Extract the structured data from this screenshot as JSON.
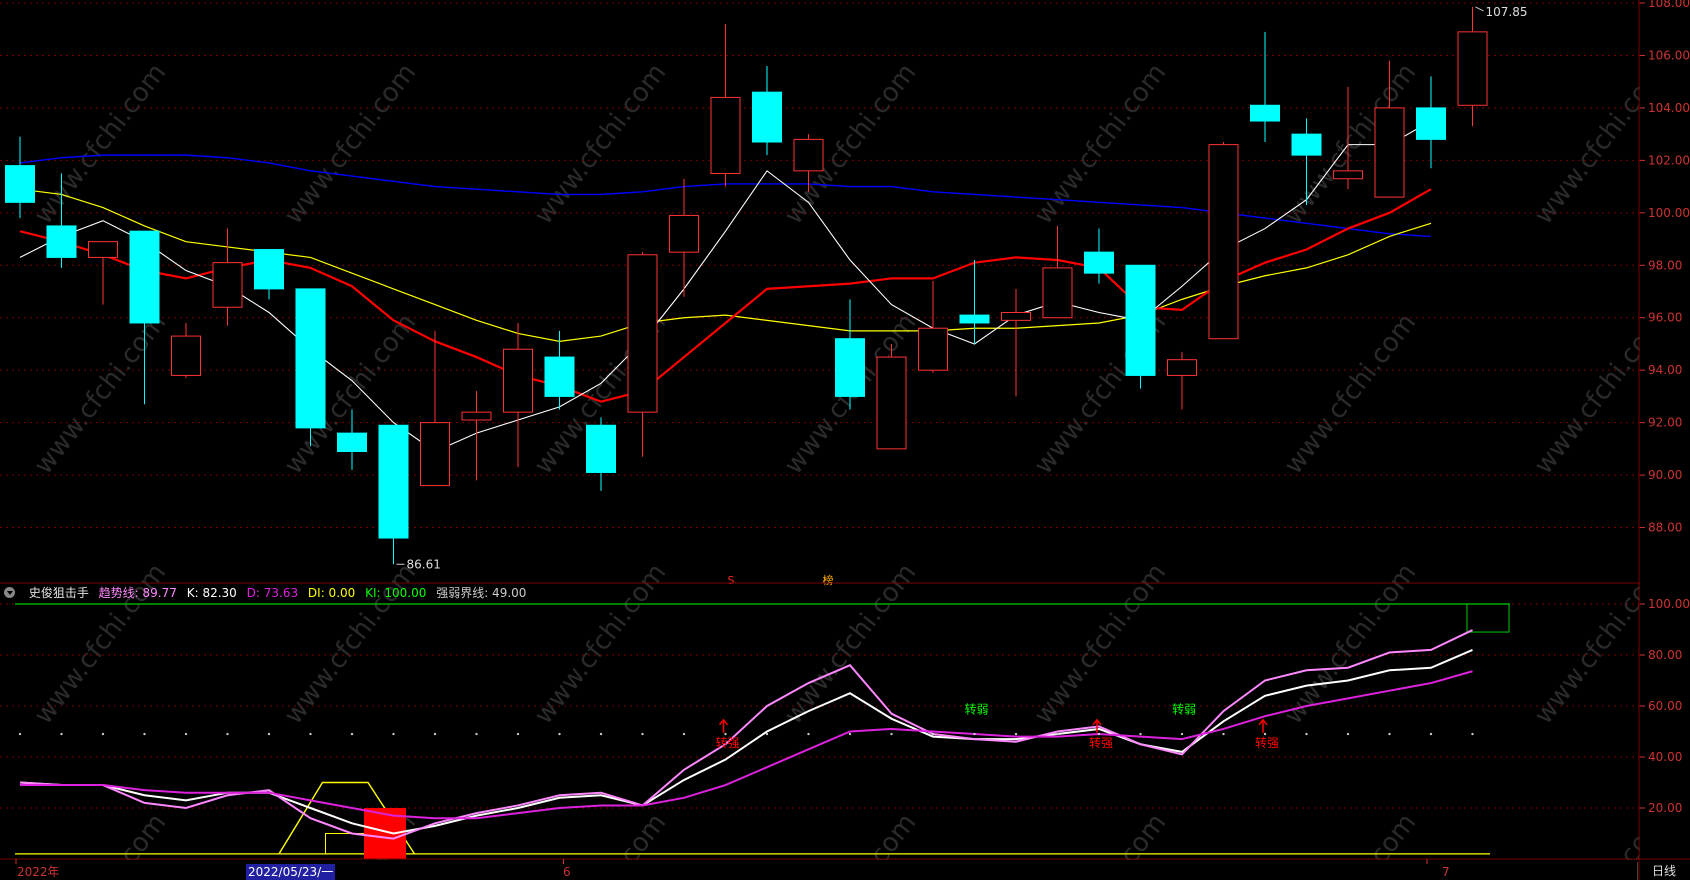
{
  "colors": {
    "up": "#ff3232",
    "down": "#00ffff",
    "ma_white": "#ffffff",
    "ma_red": "#ff0000",
    "ma_yellow": "#ffff00",
    "ma_blue": "#0000ff",
    "grid": "#7a0000",
    "axis_text": "#cc3333"
  },
  "indicator_header": {
    "name": "史俊狙击手",
    "trend_label": "趋势线: 89.77",
    "k_label": "K: 82.30",
    "d_label": "D: 73.63",
    "di_label": "DI: 0.00",
    "ki_label": "KI: 100.00",
    "strong_weak_label": "强弱界线: 49.00"
  },
  "markers": {
    "high_label": "107.85",
    "low_label": "86.61",
    "s_label": "S",
    "bang_label": "榜"
  },
  "signals": [
    {
      "text": "转强",
      "index": 17,
      "value": 44,
      "color": "#ff0000"
    },
    {
      "text": "转弱",
      "index": 23,
      "value": 57,
      "color": "#00ff00"
    },
    {
      "text": "转强",
      "index": 26,
      "value": 44,
      "color": "#ff0000"
    },
    {
      "text": "转弱",
      "index": 28,
      "value": 57,
      "color": "#00ff00"
    },
    {
      "text": "转强",
      "index": 30,
      "value": 44,
      "color": "#ff0000"
    }
  ],
  "timeline": {
    "year_label": "2022年",
    "selected_date": "2022/05/23/一",
    "month_6": "6",
    "month_7": "7",
    "period_button": "日线"
  },
  "chart_data": [
    {
      "type": "candlestick",
      "ylim": [
        86,
        108
      ],
      "yticks": [
        "88.00",
        "90.00",
        "92.00",
        "94.00",
        "96.00",
        "98.00",
        "100.00",
        "102.00",
        "104.00",
        "106.00",
        "108.00"
      ],
      "candles": [
        {
          "o": 101.8,
          "h": 102.9,
          "l": 99.8,
          "c": 100.4
        },
        {
          "o": 99.5,
          "h": 101.5,
          "l": 97.9,
          "c": 98.3
        },
        {
          "o": 98.3,
          "h": 98.9,
          "l": 96.5,
          "c": 98.9
        },
        {
          "o": 99.3,
          "h": 99.3,
          "l": 92.7,
          "c": 95.8
        },
        {
          "o": 93.8,
          "h": 95.8,
          "l": 93.7,
          "c": 95.3
        },
        {
          "o": 96.4,
          "h": 99.4,
          "l": 95.7,
          "c": 98.1
        },
        {
          "o": 98.6,
          "h": 98.6,
          "l": 96.7,
          "c": 97.1
        },
        {
          "o": 97.1,
          "h": 97.1,
          "l": 91.1,
          "c": 91.8
        },
        {
          "o": 91.6,
          "h": 92.5,
          "l": 90.2,
          "c": 90.9
        },
        {
          "o": 91.9,
          "h": 91.9,
          "l": 86.6,
          "c": 87.6
        },
        {
          "o": 89.6,
          "h": 95.5,
          "l": 89.6,
          "c": 92.0
        },
        {
          "o": 92.1,
          "h": 93.2,
          "l": 89.8,
          "c": 92.4
        },
        {
          "o": 92.4,
          "h": 95.8,
          "l": 90.3,
          "c": 94.8
        },
        {
          "o": 94.5,
          "h": 95.5,
          "l": 92.5,
          "c": 93.0
        },
        {
          "o": 91.9,
          "h": 92.2,
          "l": 89.4,
          "c": 90.1
        },
        {
          "o": 92.4,
          "h": 98.5,
          "l": 90.7,
          "c": 98.4
        },
        {
          "o": 98.5,
          "h": 101.3,
          "l": 96.8,
          "c": 99.9
        },
        {
          "o": 101.5,
          "h": 107.2,
          "l": 101.0,
          "c": 104.4
        },
        {
          "o": 104.6,
          "h": 105.6,
          "l": 102.2,
          "c": 102.7
        },
        {
          "o": 101.6,
          "h": 103.0,
          "l": 100.8,
          "c": 102.8
        },
        {
          "o": 95.2,
          "h": 96.7,
          "l": 92.5,
          "c": 93.0
        },
        {
          "o": 91.0,
          "h": 95.0,
          "l": 91.0,
          "c": 94.5
        },
        {
          "o": 94.0,
          "h": 97.4,
          "l": 93.9,
          "c": 95.6
        },
        {
          "o": 96.1,
          "h": 98.2,
          "l": 95.0,
          "c": 95.8
        },
        {
          "o": 95.9,
          "h": 97.1,
          "l": 93.0,
          "c": 96.2
        },
        {
          "o": 96.0,
          "h": 99.5,
          "l": 96.0,
          "c": 97.9
        },
        {
          "o": 98.5,
          "h": 99.4,
          "l": 97.3,
          "c": 97.7
        },
        {
          "o": 98.0,
          "h": 98.0,
          "l": 93.3,
          "c": 93.8
        },
        {
          "o": 93.8,
          "h": 94.7,
          "l": 92.5,
          "c": 94.4
        },
        {
          "o": 95.2,
          "h": 102.7,
          "l": 95.2,
          "c": 102.6
        },
        {
          "o": 104.1,
          "h": 106.9,
          "l": 102.7,
          "c": 103.5
        },
        {
          "o": 103.0,
          "h": 103.6,
          "l": 100.3,
          "c": 102.2
        },
        {
          "o": 101.3,
          "h": 104.8,
          "l": 100.9,
          "c": 101.6
        },
        {
          "o": 100.6,
          "h": 105.8,
          "l": 100.6,
          "c": 104.0
        },
        {
          "o": 104.0,
          "h": 105.2,
          "l": 101.7,
          "c": 102.8
        },
        {
          "o": 104.1,
          "h": 107.85,
          "l": 103.3,
          "c": 106.9
        }
      ],
      "ma_white": [
        98.3,
        99.1,
        99.7,
        98.9,
        97.8,
        97.2,
        96.2,
        94.8,
        93.6,
        92.0,
        90.9,
        91.6,
        92.1,
        92.6,
        93.5,
        95.1,
        97.1,
        99.3,
        101.6,
        100.4,
        98.2,
        96.5,
        95.6,
        95.0,
        96.1,
        96.6,
        96.2,
        95.9,
        97.2,
        98.6,
        99.4,
        100.5,
        102.6,
        102.6,
        103.5
      ],
      "ma_red": [
        99.3,
        98.9,
        98.4,
        97.8,
        97.5,
        97.9,
        98.2,
        97.9,
        97.2,
        95.9,
        95.1,
        94.5,
        93.8,
        93.4,
        92.8,
        93.2,
        94.5,
        95.8,
        97.1,
        97.2,
        97.3,
        97.5,
        97.5,
        98.1,
        98.3,
        98.2,
        97.9,
        96.4,
        96.3,
        97.4,
        98.1,
        98.6,
        99.4,
        100.0,
        100.9
      ],
      "ma_yellow": [
        100.9,
        100.7,
        100.2,
        99.5,
        98.9,
        98.7,
        98.5,
        98.3,
        97.7,
        97.1,
        96.5,
        95.9,
        95.4,
        95.1,
        95.3,
        95.8,
        96.0,
        96.1,
        95.9,
        95.7,
        95.5,
        95.5,
        95.5,
        95.6,
        95.6,
        95.7,
        95.8,
        96.1,
        96.7,
        97.2,
        97.6,
        97.9,
        98.4,
        99.1,
        99.6
      ],
      "ma_blue": [
        101.9,
        102.1,
        102.2,
        102.2,
        102.2,
        102.1,
        101.9,
        101.6,
        101.4,
        101.2,
        101.0,
        100.9,
        100.8,
        100.7,
        100.7,
        100.8,
        101.0,
        101.1,
        101.1,
        101.1,
        101.0,
        101.0,
        100.8,
        100.7,
        100.6,
        100.5,
        100.4,
        100.3,
        100.2,
        100.0,
        99.8,
        99.6,
        99.4,
        99.2,
        99.1
      ]
    },
    {
      "type": "line",
      "ylim": [
        0,
        100
      ],
      "yticks": [
        "20.00",
        "40.00",
        "60.00",
        "80.00",
        "100.00"
      ],
      "series": [
        {
          "name": "K",
          "color": "#ffffff",
          "values": [
            30,
            29,
            29,
            25,
            23,
            26,
            26,
            20,
            14,
            10,
            13,
            17,
            20,
            24,
            25,
            21,
            31,
            39,
            50,
            58,
            65,
            55,
            48,
            47,
            47,
            49,
            51,
            45,
            42,
            54,
            64,
            68,
            70,
            74,
            75,
            82
          ]
        },
        {
          "name": "趋势线",
          "color": "#ff88ff",
          "values": [
            30,
            29,
            29,
            22,
            20,
            25,
            27,
            16,
            10,
            8,
            14,
            18,
            21,
            25,
            26,
            21,
            35,
            45,
            60,
            69,
            76,
            57,
            49,
            47,
            46,
            50,
            52,
            45,
            41,
            58,
            70,
            74,
            75,
            81,
            82,
            89.77
          ]
        },
        {
          "name": "D",
          "color": "#dd22dd",
          "values": [
            29,
            29,
            29,
            27,
            26,
            26,
            26,
            23,
            20,
            17,
            16,
            16,
            18,
            20,
            21,
            21,
            24,
            29,
            36,
            43,
            50,
            51,
            50,
            49,
            48,
            48,
            49,
            48,
            47,
            51,
            56,
            60,
            63,
            66,
            69,
            73.63
          ]
        },
        {
          "name": "强弱界线",
          "color": "#cccccc",
          "values": [
            49,
            49,
            49,
            49,
            49,
            49,
            49,
            49,
            49,
            49,
            49,
            49,
            49,
            49,
            49,
            49,
            49,
            49,
            49,
            49,
            49,
            49,
            49,
            49,
            49,
            49,
            49,
            49,
            49,
            49,
            49,
            49,
            49,
            49,
            49,
            49
          ]
        }
      ]
    }
  ]
}
